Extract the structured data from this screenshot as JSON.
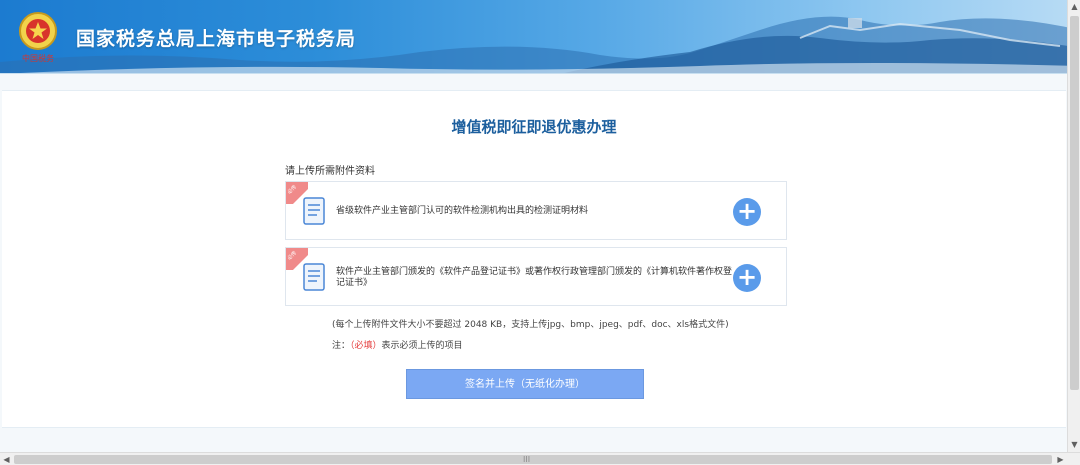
{
  "header": {
    "site_title": "国家税务总局上海市电子税务局",
    "emblem_caption": "中国税务"
  },
  "main": {
    "page_title": "增值税即征即退优惠办理",
    "upload_hint": "请上传所需附件资料",
    "attachments": [
      {
        "ribbon": "必传",
        "label": "省级软件产业主管部门认可的软件检测机构出具的检测证明材料"
      },
      {
        "ribbon": "必传",
        "label": "软件产业主管部门颁发的《软件产品登记证书》或著作权行政管理部门颁发的《计算机软件著作权登记证书》"
      }
    ],
    "note_size": "(每个上传附件文件大小不要超过 2048 KB，支持上传jpg、bmp、jpeg、pdf、doc、xls格式文件)",
    "note_prefix": "注：",
    "note_required": "（必填）",
    "note_suffix": "表示必须上传的项目",
    "submit_label": "签名并上传（无纸化办理）"
  },
  "colors": {
    "accent": "#5a9bea",
    "title": "#1c5f9e",
    "required": "#e53c3c",
    "submit": "#7ba8f3"
  },
  "icons": {
    "emblem": "tax-emblem-icon",
    "document": "document-icon",
    "add": "plus-icon"
  },
  "scrollbar": {
    "up": "▲",
    "down": "▼",
    "left": "◀",
    "right": "▶",
    "grip": "III"
  }
}
